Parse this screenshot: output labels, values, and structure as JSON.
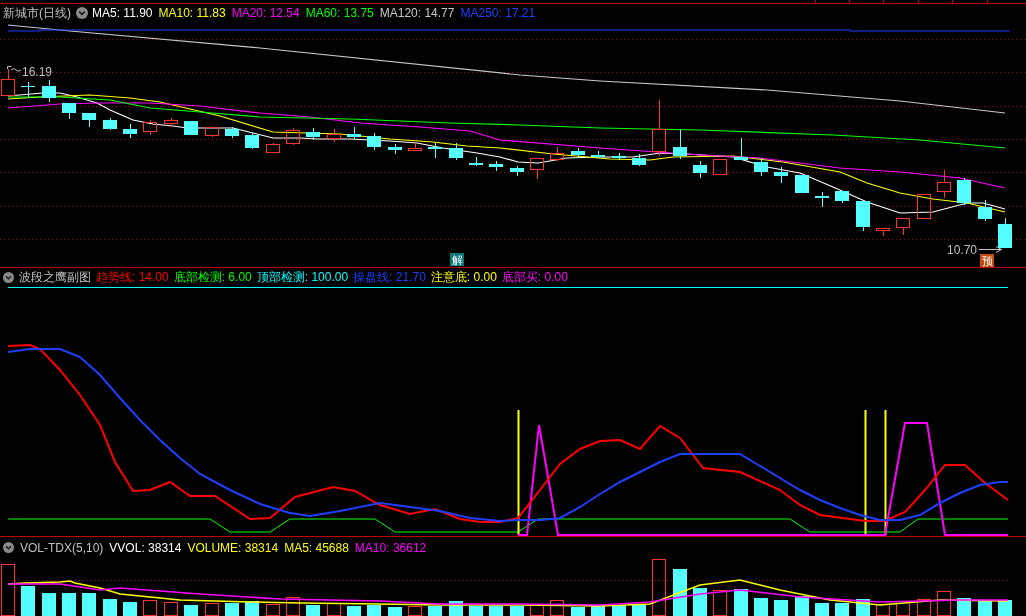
{
  "main_chart": {
    "title": "新城市(日线)",
    "indicators": [
      {
        "label": "MA5: 11.90",
        "color": "#ffffff"
      },
      {
        "label": "MA10: 11.83",
        "color": "#ffff00"
      },
      {
        "label": "MA20: 12.54",
        "color": "#ff00ff"
      },
      {
        "label": "MA60: 13.75",
        "color": "#00ff00"
      },
      {
        "label": "MA120: 14.77",
        "color": "#c8c8c8"
      },
      {
        "label": "MA250: 17.21",
        "color": "#1f3fff"
      }
    ],
    "high_price_label": "16.19",
    "low_price_label": "10.70",
    "signal_badge": "解",
    "forecast_badge": "预"
  },
  "sub_chart": {
    "title": "波段之鹰副图",
    "indicators": [
      {
        "label": "趋势线: 14.00",
        "color": "#ff0000"
      },
      {
        "label": "底部检测: 6.00",
        "color": "#00ff00"
      },
      {
        "label": "顶部检测: 100.00",
        "color": "#00ffff"
      },
      {
        "label": "操盘线: 21.70",
        "color": "#1f3fff"
      },
      {
        "label": "注意底: 0.00",
        "color": "#ffff00"
      },
      {
        "label": "底部买: 0.00",
        "color": "#ff00ff"
      }
    ]
  },
  "volume_chart": {
    "title": "VOL-TDX(5,10)",
    "indicators": [
      {
        "label": "VVOL: 38314",
        "color": "#ffffff"
      },
      {
        "label": "VOLUME: 38314",
        "color": "#ffff00"
      },
      {
        "label": "MA5: 45688",
        "color": "#ffff00"
      },
      {
        "label": "MA10: 36612",
        "color": "#ff00ff"
      }
    ]
  }
}
